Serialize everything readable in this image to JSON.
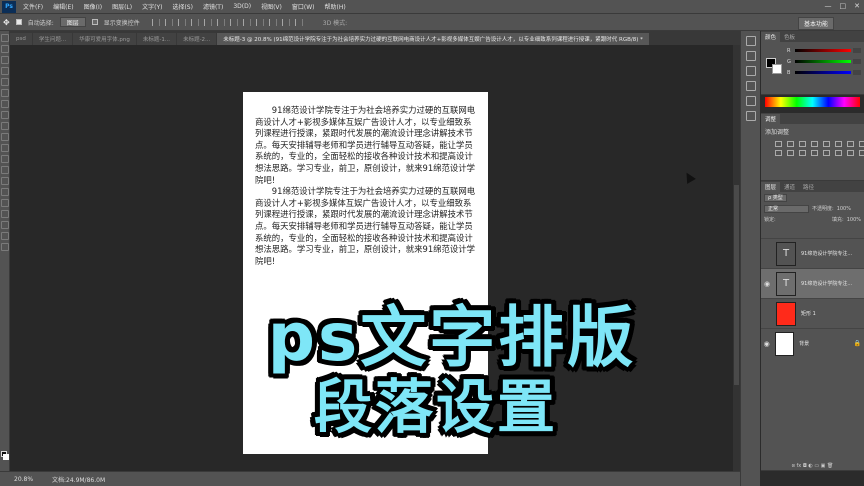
{
  "app": {
    "logo": "Ps"
  },
  "menu": [
    "文件(F)",
    "编辑(E)",
    "图像(I)",
    "图层(L)",
    "文字(Y)",
    "选择(S)",
    "滤镜(T)",
    "3D(D)",
    "视图(V)",
    "窗口(W)",
    "帮助(H)"
  ],
  "window_controls": [
    "—",
    "□",
    "✕"
  ],
  "options": {
    "auto_select_label": "自动选择:",
    "auto_select_value": "图层",
    "show_transform_label": "显示变换控件",
    "mode_3d_label": "3D 模式:",
    "workspace": "基本功能"
  },
  "tabs": [
    {
      "label": "psd"
    },
    {
      "label": "学生问题..."
    },
    {
      "label": "华康可爱用字体.png"
    },
    {
      "label": "未标题-1..."
    },
    {
      "label": "未标题-2..."
    },
    {
      "label": "未标题-3 @ 20.8% (91绵范设计学院专注于为社会培养实力过硬的互联网电商设计人才+影视多媒体互娱广告设计人才，以专业细致系列课程进行授课，紧跟时代 RGB/8) *"
    }
  ],
  "document": {
    "paragraphs": [
      "91绵范设计学院专注于为社会培养实力过硬的互联网电商设计人才+影视多媒体互娱广告设计人才，以专业细致系列课程进行授课，紧跟时代发展的潮流设计理念讲解技术节点。每天安排辅导老师和学员进行辅导互动答疑，能让学员系统的，专业的，全面轻松的接收各种设计技术和提高设计想法思路。学习专业，前卫，原创设计，就来91绵范设计学院吧!",
      "91绵范设计学院专注于为社会培养实力过硬的互联网电商设计人才+影视多媒体互娱广告设计人才，以专业细致系列课程进行授课，紧跟时代发展的潮流设计理念讲解技术节点。每天安排辅导老师和学员进行辅导互动答疑，能让学员系统的，专业的，全面轻松的接收各种设计技术和提高设计想法思路。学习专业，前卫，原创设计，就来91绵范设计学院吧!"
    ]
  },
  "overlay": {
    "line1": "ps文字排版",
    "line2": "段落设置"
  },
  "status": {
    "zoom": "20.8%",
    "doc_info": "文档:24.9M/86.0M"
  },
  "color_panel": {
    "tabs": [
      "颜色",
      "色板"
    ],
    "sliders": [
      {
        "label": "R"
      },
      {
        "label": "G"
      },
      {
        "label": "B"
      }
    ]
  },
  "adjust_panel": {
    "tab": "调整",
    "subtitle": "添加调整"
  },
  "layers_panel": {
    "tabs": [
      "图层",
      "通道",
      "路径"
    ],
    "filter": "ρ 类型",
    "blend_mode": "正常",
    "opacity_label": "不透明度:",
    "opacity_value": "100%",
    "lock_label": "锁定:",
    "fill_label": "填充:",
    "fill_value": "100%",
    "layers": [
      {
        "name": "91绵范设计学院专注...",
        "type": "text",
        "visible": false,
        "selected": false
      },
      {
        "name": "91绵范设计学院专注...",
        "type": "text",
        "visible": true,
        "selected": true
      },
      {
        "name": "矩形 1",
        "type": "shape",
        "visible": false,
        "selected": false
      },
      {
        "name": "背景",
        "type": "background",
        "visible": true,
        "selected": false
      }
    ],
    "footer_icons": "ɞ fx ◘ ◐ ▭ ▣ 🗑"
  },
  "colors": {
    "accent_red": "#ff2a1a",
    "overlay_text": "#7ee6f7"
  }
}
